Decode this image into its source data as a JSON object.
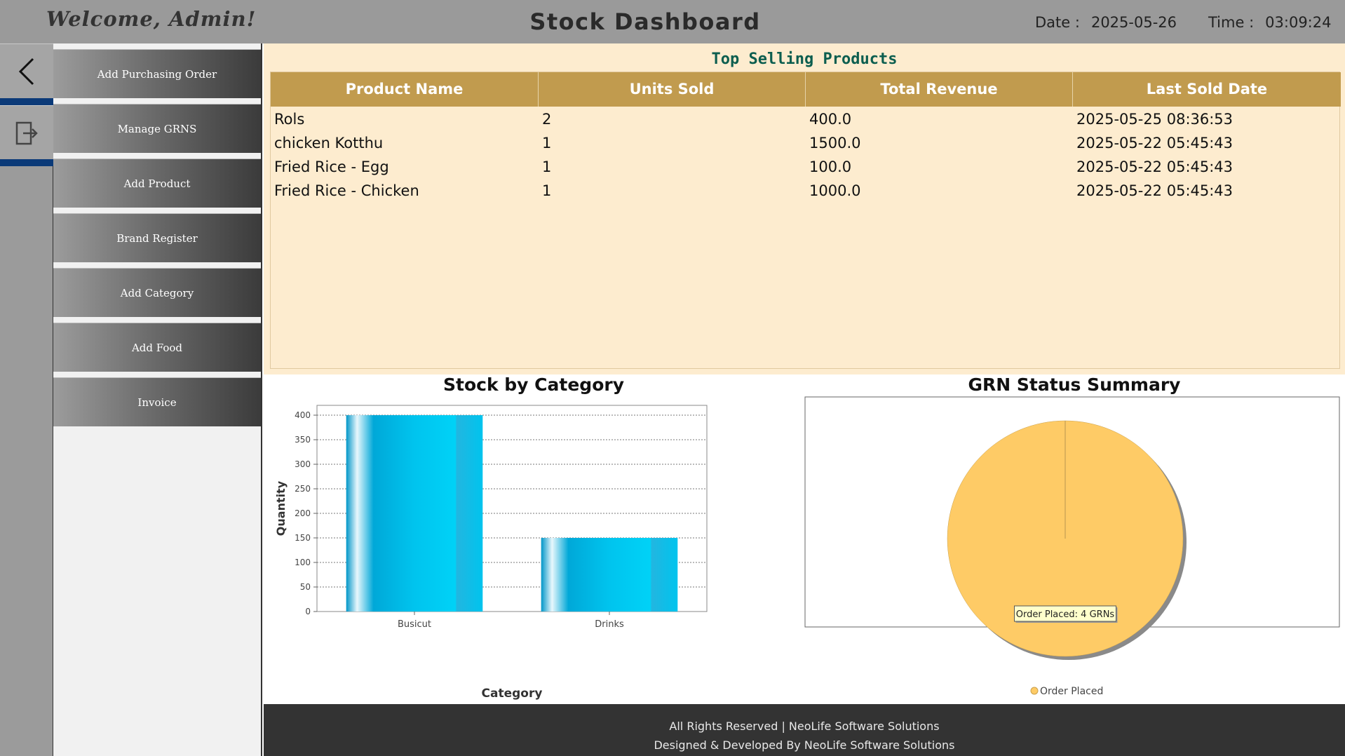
{
  "header": {
    "welcome": "Welcome, Admin!",
    "title": "Stock Dashboard",
    "date_label": "Date :",
    "date_value": "2025-05-26",
    "time_label": "Time :",
    "time_value": "03:09:24"
  },
  "rail": {
    "back_icon": "chevron-left-icon",
    "logout_icon": "logout-icon"
  },
  "menu": {
    "items": [
      {
        "label": "Add Purchasing Order"
      },
      {
        "label": "Manage GRNS"
      },
      {
        "label": "Add Product"
      },
      {
        "label": "Brand Register"
      },
      {
        "label": "Add Category"
      },
      {
        "label": "Add Food"
      },
      {
        "label": "Invoice"
      }
    ]
  },
  "top_selling": {
    "title": "Top Selling Products",
    "columns": [
      "Product Name",
      "Units Sold",
      "Total Revenue",
      "Last Sold Date"
    ],
    "rows": [
      [
        "Rols",
        "2",
        "400.0",
        "2025-05-25 08:36:53"
      ],
      [
        "chicken Kotthu",
        "1",
        "1500.0",
        "2025-05-22 05:45:43"
      ],
      [
        "Fried Rice - Egg",
        "1",
        "100.0",
        "2025-05-22 05:45:43"
      ],
      [
        "Fried Rice - Chicken",
        "1",
        "1000.0",
        "2025-05-22 05:45:43"
      ]
    ]
  },
  "chart_data": [
    {
      "type": "bar",
      "title": "Stock by Category",
      "xlabel": "Category",
      "ylabel": "Quantity",
      "categories": [
        "Busicut",
        "Drinks"
      ],
      "values": [
        400,
        150
      ],
      "ylim": [
        0,
        420
      ],
      "yticks": [
        "0",
        "50",
        "100",
        "150",
        "200",
        "250",
        "300",
        "350",
        "400"
      ],
      "grid": true,
      "bar_color": "#00b4e6"
    },
    {
      "type": "pie",
      "title": "GRN Status Summary",
      "labels": [
        "Order Placed"
      ],
      "values": [
        4
      ],
      "slice_label": "Order Placed: 4 GRNs",
      "legend": "bottom",
      "colors": [
        "#fecb66"
      ]
    }
  ],
  "footer": {
    "line1": "All Rights Reserved | NeoLife Software Solutions",
    "line2": "Designed & Developed By NeoLife Software Solutions"
  }
}
